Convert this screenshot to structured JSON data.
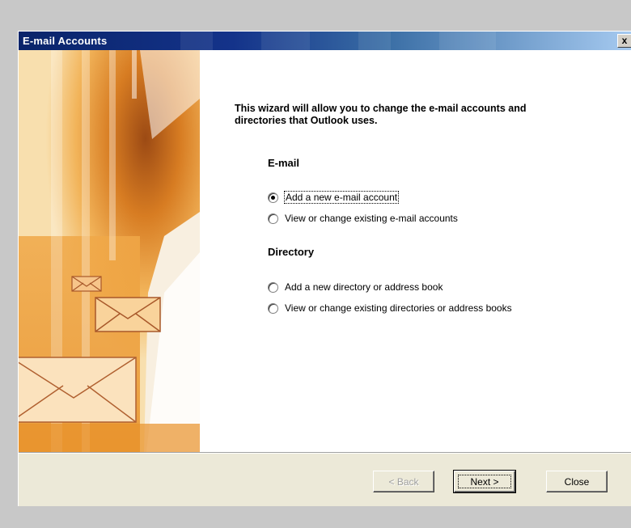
{
  "window": {
    "title": "E-mail Accounts",
    "close_glyph": "x"
  },
  "content": {
    "intro": "This wizard will allow you to change the e-mail accounts and directories that Outlook uses.",
    "email_section": {
      "heading": "E-mail",
      "options": [
        {
          "label": "Add a new e-mail account",
          "checked": true
        },
        {
          "label": "View or change existing e-mail accounts",
          "checked": false
        }
      ]
    },
    "directory_section": {
      "heading": "Directory",
      "options": [
        {
          "label": "Add a new directory or address book",
          "checked": false
        },
        {
          "label": "View or change existing directories or address books",
          "checked": false
        }
      ]
    }
  },
  "buttons": {
    "back": "< Back",
    "next": "Next >",
    "close": "Close"
  },
  "colors": {
    "titlebar_start": "#0a246a",
    "titlebar_end": "#a6caf0",
    "dialog_face": "#ece9d8",
    "art_orange": "#e8922a"
  },
  "icons": {
    "close": "close-icon",
    "envelope": "envelope-icon"
  }
}
